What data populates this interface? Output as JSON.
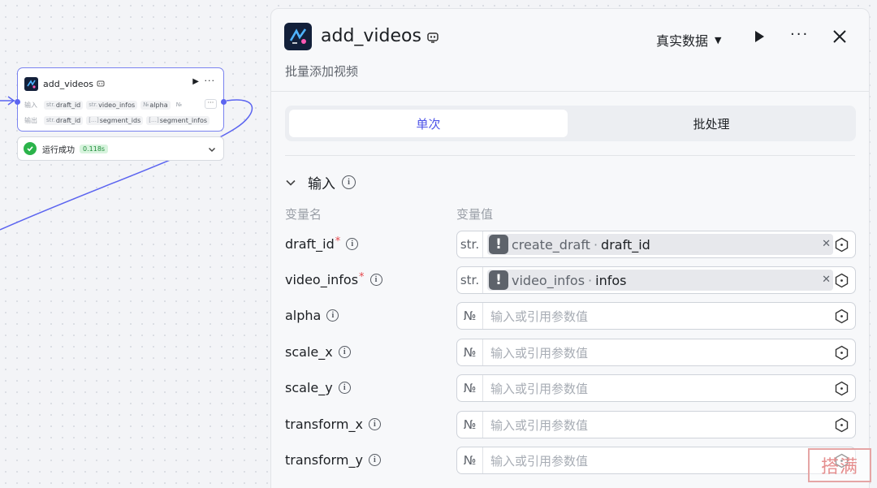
{
  "node": {
    "title": "add_videos",
    "inputs_label": "输入",
    "outputs_label": "输出",
    "inputs": [
      {
        "type": "str.",
        "name": "draft_id"
      },
      {
        "type": "str.",
        "name": "video_infos"
      },
      {
        "type": "№",
        "name": "alpha"
      },
      {
        "type": "№",
        "name": ""
      }
    ],
    "outputs": [
      {
        "type": "str.",
        "name": "draft_id"
      },
      {
        "type": "[…]",
        "name": "segment_ids"
      },
      {
        "type": "[…]",
        "name": "segment_infos"
      }
    ],
    "status": {
      "text": "运行成功",
      "time": "0.118s"
    }
  },
  "panel": {
    "title": "add_videos",
    "description": "批量添加视频",
    "mode_label": "真实数据",
    "tabs": [
      {
        "label": "单次",
        "active": true
      },
      {
        "label": "批处理",
        "active": false
      }
    ],
    "section_title": "输入",
    "column_name": "变量名",
    "column_value": "变量值",
    "variables": [
      {
        "name": "draft_id",
        "required": true,
        "type": "str.",
        "ref": {
          "source": "create_draft",
          "field": "draft_id"
        }
      },
      {
        "name": "video_infos",
        "required": true,
        "type": "str.",
        "ref": {
          "source": "video_infos",
          "field": "infos"
        }
      },
      {
        "name": "alpha",
        "required": false,
        "type": "№",
        "placeholder": "输入或引用参数值"
      },
      {
        "name": "scale_x",
        "required": false,
        "type": "№",
        "placeholder": "输入或引用参数值"
      },
      {
        "name": "scale_y",
        "required": false,
        "type": "№",
        "placeholder": "输入或引用参数值"
      },
      {
        "name": "transform_x",
        "required": false,
        "type": "№",
        "placeholder": "输入或引用参数值"
      },
      {
        "name": "transform_y",
        "required": false,
        "type": "№",
        "placeholder": "输入或引用参数值"
      }
    ]
  },
  "watermark": "搭满",
  "colors": {
    "accent": "#4d53e8",
    "success": "#2bb34a",
    "edge": "#5b64f0",
    "required": "#e5484d"
  }
}
